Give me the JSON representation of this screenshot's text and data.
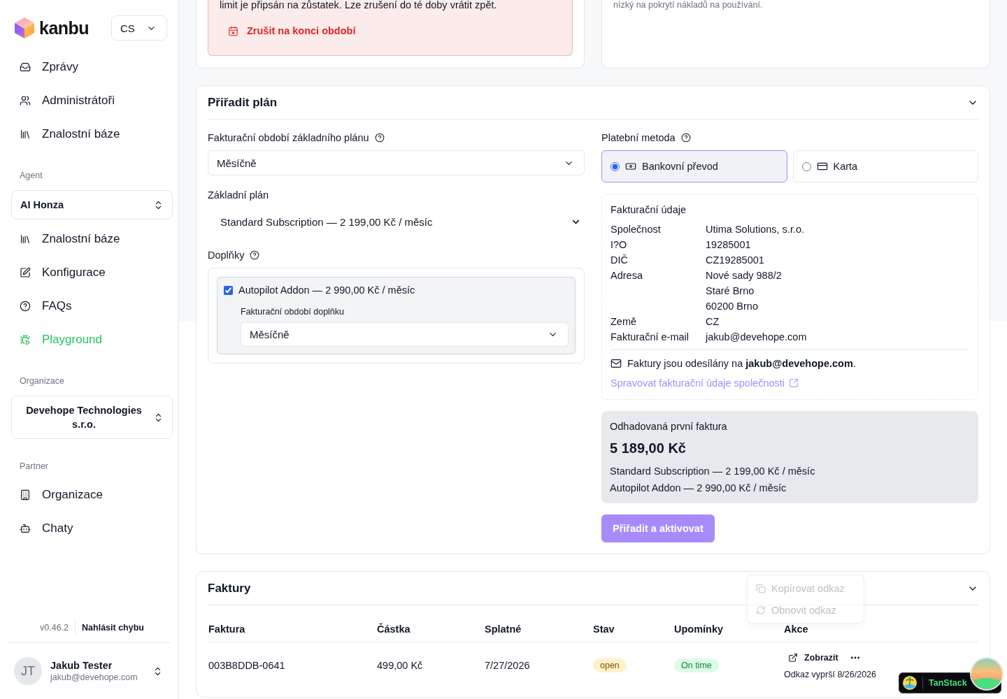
{
  "sidebar": {
    "brand": "kanbu",
    "language": "CS",
    "nav": [
      {
        "label": "Zprávy",
        "selected": false
      },
      {
        "label": "Administrátoři",
        "selected": false
      },
      {
        "label": "Znalostní báze",
        "selected": false
      }
    ],
    "agent": {
      "heading": "Agent",
      "selector": "AI Honza",
      "nav": [
        {
          "label": "Znalostní báze",
          "selected": false
        },
        {
          "label": "Konfigurace",
          "selected": false
        },
        {
          "label": "FAQs",
          "selected": false
        },
        {
          "label": "Playground",
          "selected": true
        }
      ]
    },
    "organization": {
      "heading": "Organizace",
      "selector": "Devehope Technologies s.r.o."
    },
    "partner": {
      "heading": "Partner",
      "nav": [
        {
          "label": "Organizace",
          "selected": false
        },
        {
          "label": "Chaty",
          "selected": false
        }
      ]
    },
    "footer": {
      "version": "v0.46.2",
      "report_link": "Nahlásit chybu"
    },
    "user": {
      "initials": "JT",
      "name": "Jakub Tester",
      "email": "jakub@devehope.com"
    }
  },
  "cancel_notice": {
    "text": "limit je připsán na zůstatek. Lze zrušení do té doby vrátit zpět.",
    "action": "Zrušit na konci období"
  },
  "usage_note": {
    "text": "nízký na pokrytí nákladů na používání."
  },
  "assign_plan": {
    "title": "Přiřadit plán",
    "expanded": true,
    "billing_period": {
      "label": "Fakturační období základního plánu",
      "value": "Měsíčně"
    },
    "base_plan": {
      "label": "Základní plán",
      "value": "Standard Subscription — 2 199,00 Kč / měsíc"
    },
    "addons": {
      "label": "Doplňky",
      "items": [
        {
          "label": "Autopilot Addon — 2 990,00 Kč / měsíc",
          "checked": true,
          "period_label": "Fakturační období doplňku",
          "period_value": "Měsíčně"
        }
      ]
    },
    "payment_method": {
      "label": "Platební metoda",
      "options": [
        {
          "label": "Bankovní převod",
          "selected": true
        },
        {
          "label": "Karta",
          "selected": false
        }
      ]
    },
    "billing_details": {
      "title": "Fakturační údaje",
      "rows": [
        {
          "label": "Společnost",
          "lines": [
            "Utima Solutions, s.r.o."
          ]
        },
        {
          "label": "I?O",
          "lines": [
            "19285001"
          ]
        },
        {
          "label": "DIČ",
          "lines": [
            "CZ19285001"
          ]
        },
        {
          "label": "Adresa",
          "lines": [
            "Nové sady 988/2",
            "Staré Brno",
            "60200 Brno"
          ]
        },
        {
          "label": "Země",
          "lines": [
            "CZ"
          ]
        },
        {
          "label": "Fakturační e-mail",
          "lines": [
            "jakub@devehope.com"
          ]
        }
      ],
      "note": "Faktury jsou odesílány na **jakub@devehope.com**.",
      "manage_link": "Spravovat fakturační údaje společnosti"
    },
    "estimate": {
      "title": "Odhadovaná první faktura",
      "total": "5 189,00 Kč",
      "lines": [
        "Standard Subscription — 2 199,00 Kč / měsíc",
        "Autopilot Addon — 2 990,00 Kč / měsíc"
      ]
    },
    "submit": "Přiřadit a aktivovat"
  },
  "invoices": {
    "title": "Faktury",
    "expanded": true,
    "columns": [
      "Faktura",
      "Částka",
      "Splatné",
      "Stav",
      "Upomínky",
      "Akce"
    ],
    "rows": [
      {
        "invoice": "003B8DDB-0641",
        "amount": "499,00 Kč",
        "due": "7/27/2026",
        "status": {
          "label": "open",
          "kind": "warning"
        },
        "reminders": {
          "label": "On time",
          "kind": "success"
        },
        "view": "Zobrazit",
        "expiry": "Odkaz vyprší 8/26/2026"
      }
    ],
    "action_menu": [
      "Kopírovat odkaz",
      "Obnovit odkaz"
    ]
  },
  "devtools": {
    "label": "TanStack"
  }
}
